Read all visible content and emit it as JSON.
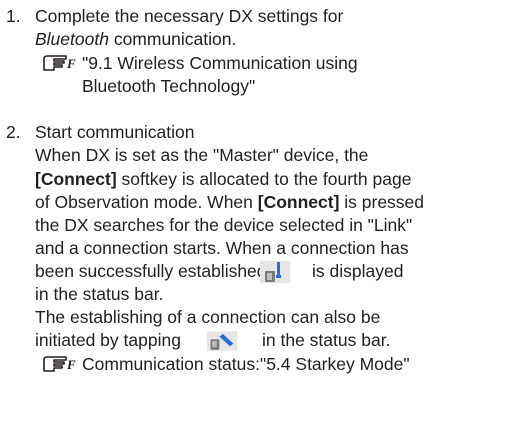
{
  "step1": {
    "number": "1.",
    "line1": "Complete the necessary DX settings for",
    "line2_italic": "Bluetooth",
    "line2_rest": " communication.",
    "ref_line1": "\"9.1 Wireless Communication using",
    "ref_line2": "Bluetooth Technology\""
  },
  "step2": {
    "number": "2.",
    "line1": "Start communication",
    "line2": "When DX is set as the \"Master\" device, the",
    "line3_bold": "[Connect]",
    "line3_rest": " softkey is allocated to the fourth page",
    "line4_a": "of Observation mode. When ",
    "line4_bold": "[Connect]",
    "line4_b": " is pressed",
    "line5": "the DX searches for the device selected in \"Link\"",
    "line6": "and a connection starts. When a connection has",
    "line7_a": "been successfully established",
    "line7_b": "is displayed",
    "line8": "in the status bar.",
    "line9": "The establishing of a connection can also be",
    "line10_a": "initiated by tapping",
    "line10_b": "in the status bar.",
    "ref": "Communication status:\"5.4 Starkey Mode\""
  },
  "icons": {
    "reference": "reference-hand-icon",
    "connected": "bluetooth-connected-status-icon",
    "connect": "bluetooth-connect-status-icon"
  }
}
